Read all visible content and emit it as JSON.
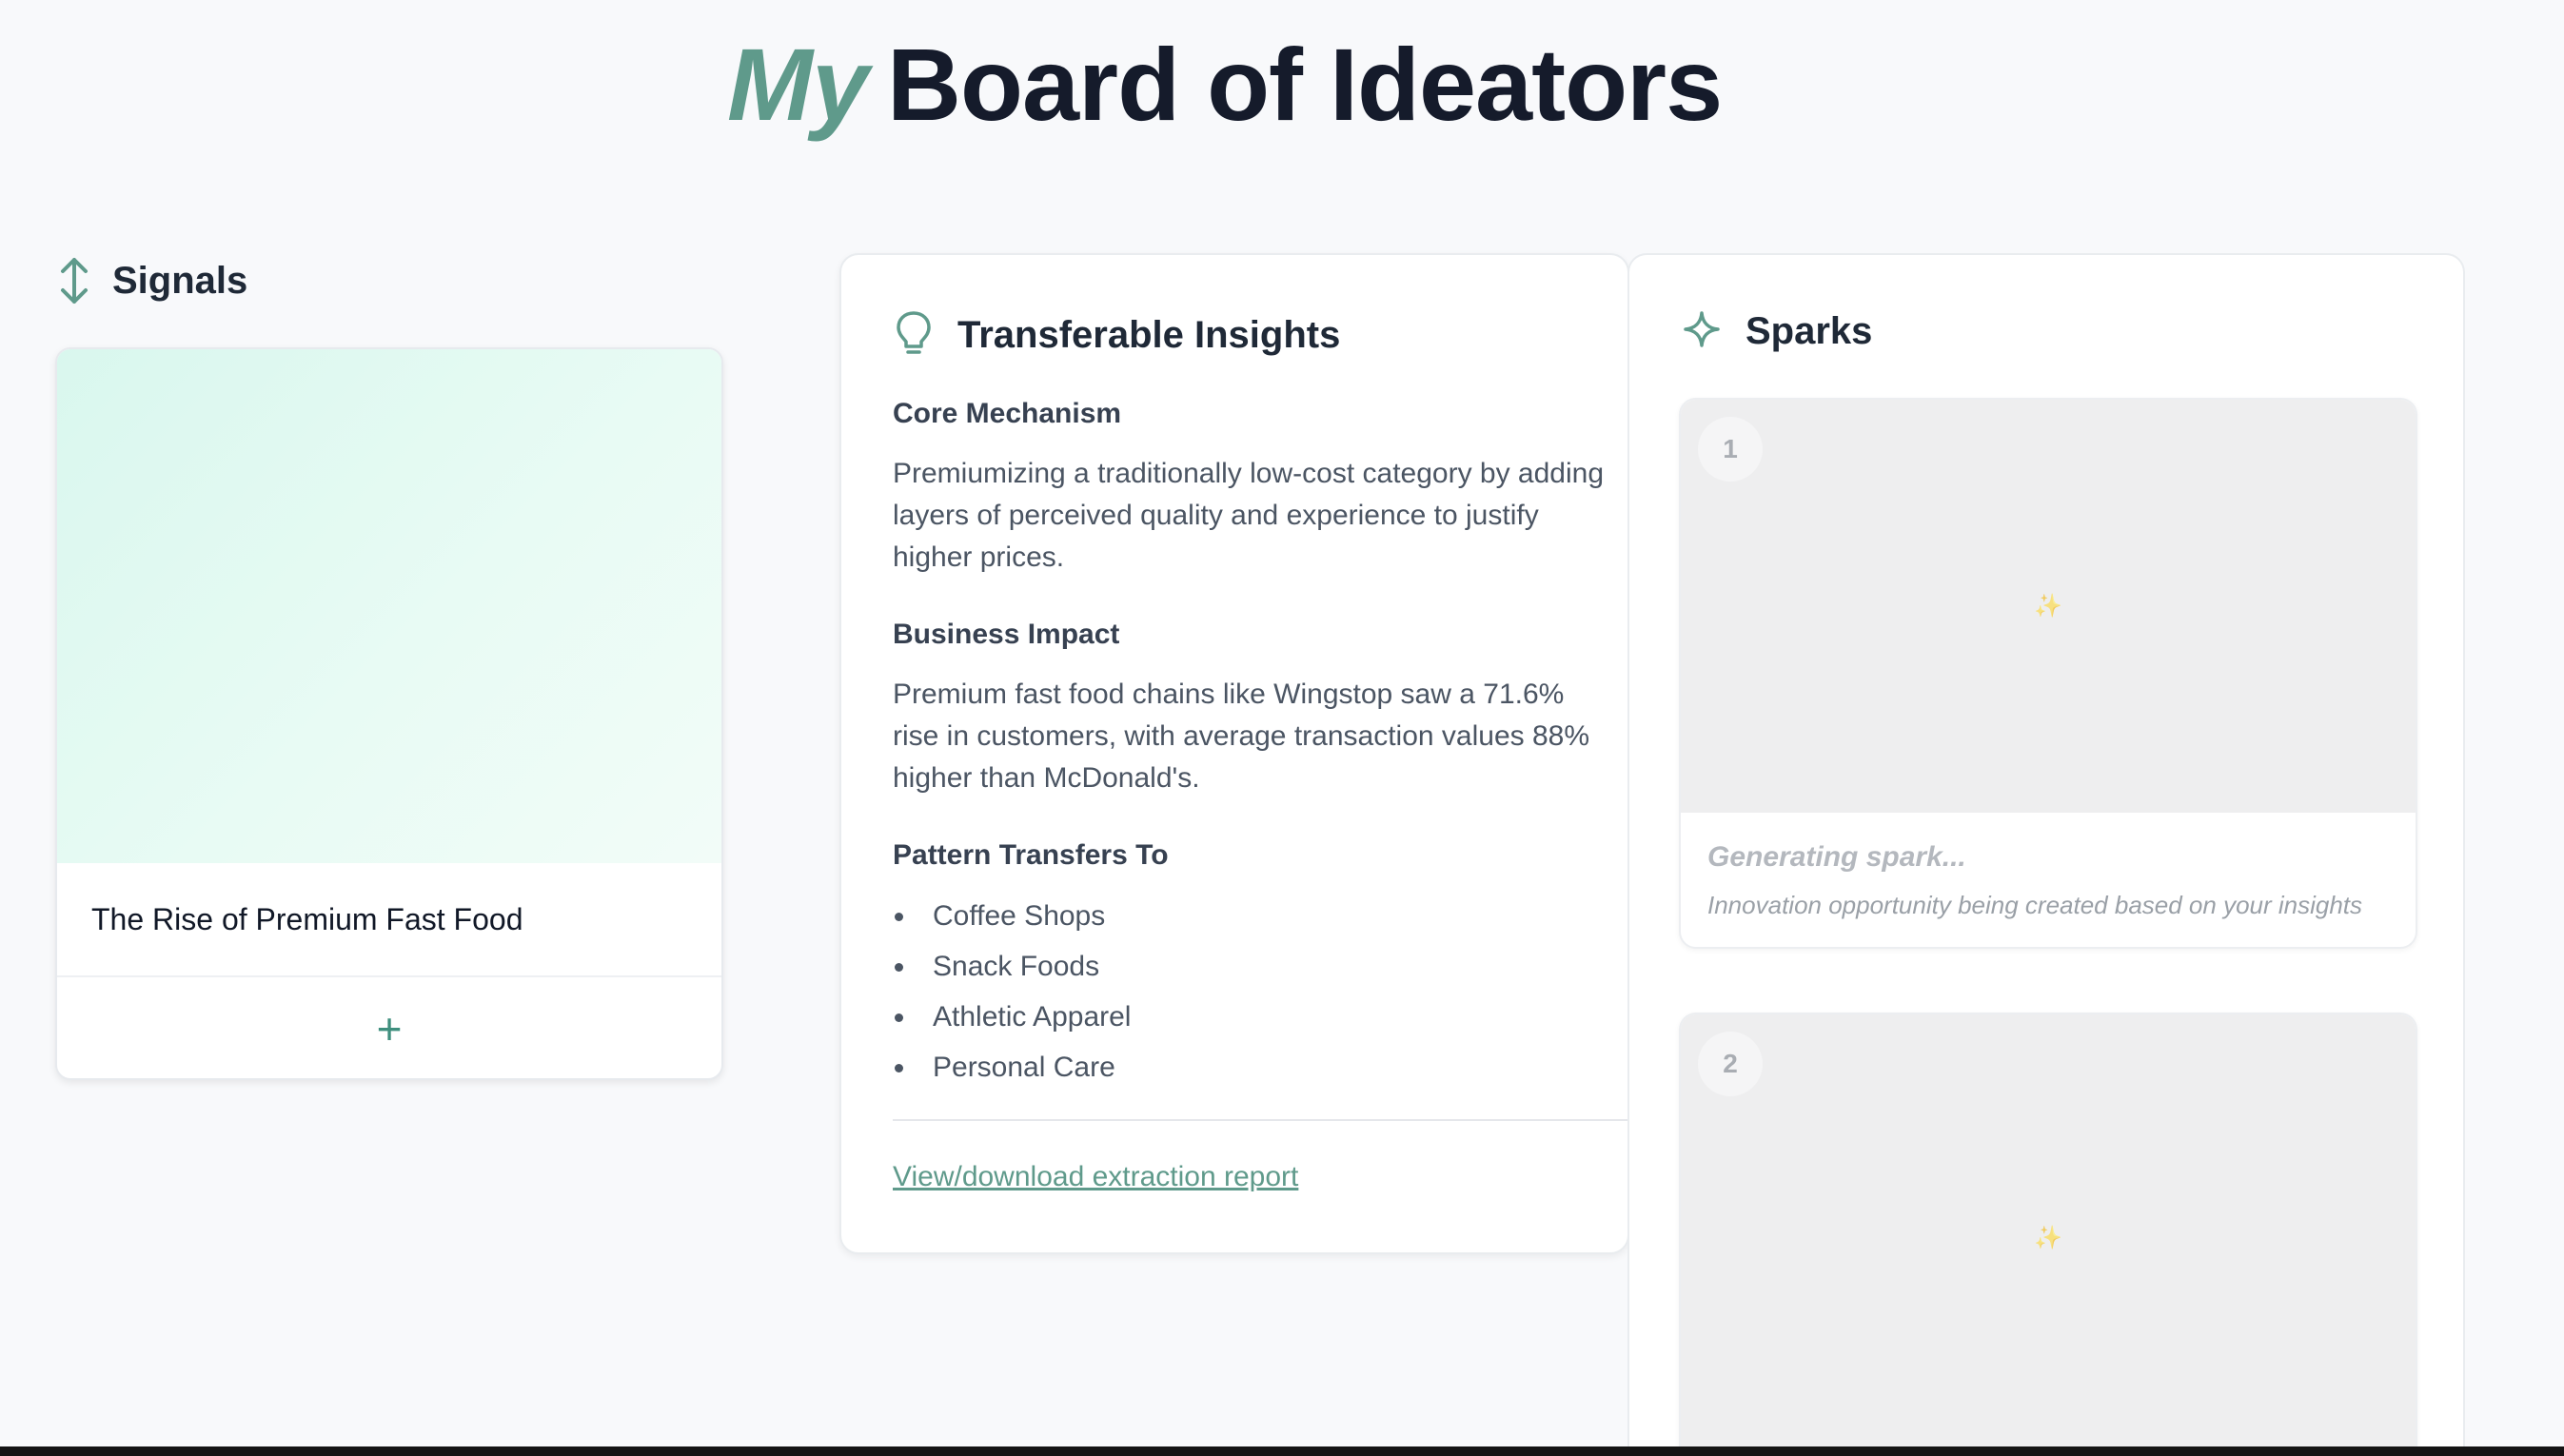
{
  "header": {
    "title_accent": "My",
    "title_main": "Board of Ideators"
  },
  "signals": {
    "title": "Signals",
    "icon": "vertical-arrows-icon",
    "cards": [
      {
        "title": "The Rise of Premium Fast Food",
        "add_label": "+"
      }
    ]
  },
  "insights": {
    "title": "Transferable Insights",
    "icon": "lightbulb-icon",
    "core_mechanism": {
      "heading": "Core Mechanism",
      "text": "Premiumizing a traditionally low-cost category by adding layers of perceived quality and experience to justify higher prices."
    },
    "business_impact": {
      "heading": "Business Impact",
      "text": "Premium fast food chains like Wingstop saw a 71.6% rise in customers, with average transaction values 88% higher than McDonald's."
    },
    "pattern_transfers": {
      "heading": "Pattern Transfers To",
      "items": [
        "Coffee Shops",
        "Snack Foods",
        "Athletic Apparel",
        "Personal Care"
      ]
    },
    "report_link": "View/download extraction report"
  },
  "sparks": {
    "title": "Sparks",
    "icon": "sparkle-icon",
    "cards": [
      {
        "number": "1",
        "glyph": "✨",
        "title": "Generating spark...",
        "description": "Innovation opportunity being created based on your insights"
      },
      {
        "number": "2",
        "glyph": "✨"
      }
    ]
  },
  "colors": {
    "accent": "#5f9a8b",
    "background": "#f8f9fb",
    "title": "#151b2b"
  }
}
